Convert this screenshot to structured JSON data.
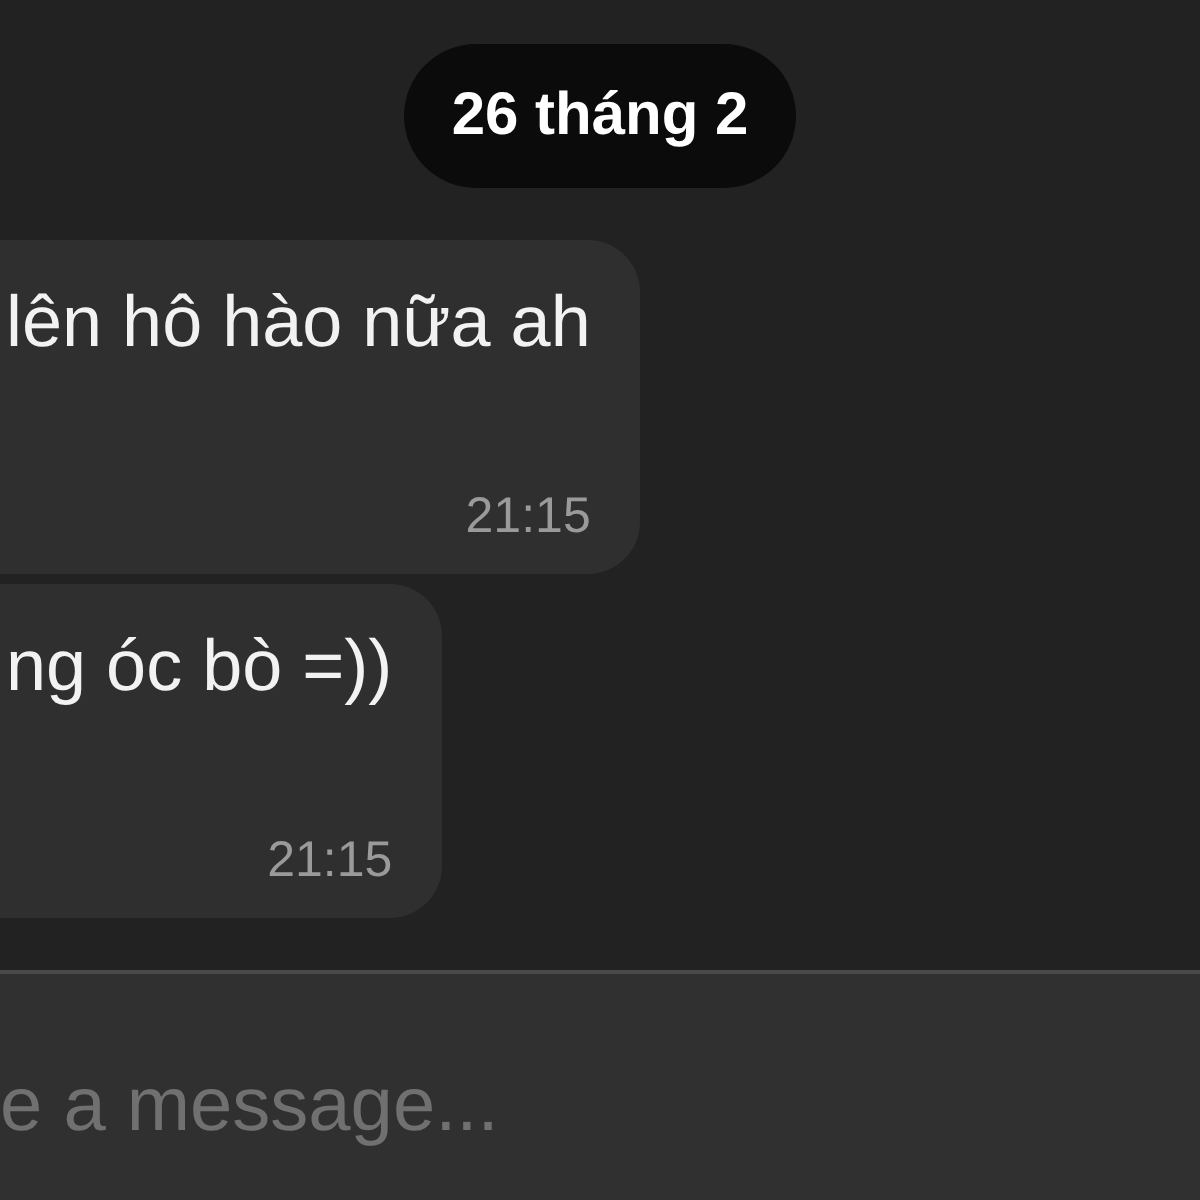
{
  "date_separator": {
    "label": "26 tháng 2"
  },
  "messages": [
    {
      "text": "lên hô hào nữa ah",
      "time": "21:15"
    },
    {
      "text": "ng óc bò =))",
      "time": "21:15"
    }
  ],
  "composer": {
    "placeholder": "e a message..."
  }
}
